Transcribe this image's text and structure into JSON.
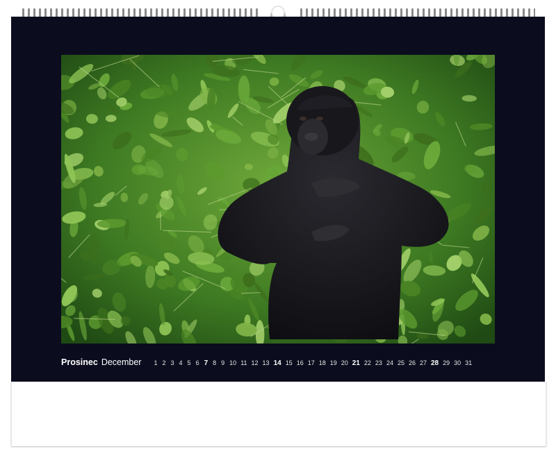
{
  "calendar": {
    "month_cz": "Prosinec",
    "month_en": "December",
    "days": [
      {
        "n": "1",
        "bold": false
      },
      {
        "n": "2",
        "bold": false
      },
      {
        "n": "3",
        "bold": false
      },
      {
        "n": "4",
        "bold": false
      },
      {
        "n": "5",
        "bold": false
      },
      {
        "n": "6",
        "bold": false
      },
      {
        "n": "7",
        "bold": true
      },
      {
        "n": "8",
        "bold": false
      },
      {
        "n": "9",
        "bold": false
      },
      {
        "n": "10",
        "bold": false
      },
      {
        "n": "11",
        "bold": false
      },
      {
        "n": "12",
        "bold": false
      },
      {
        "n": "13",
        "bold": false
      },
      {
        "n": "14",
        "bold": true
      },
      {
        "n": "15",
        "bold": false
      },
      {
        "n": "16",
        "bold": false
      },
      {
        "n": "17",
        "bold": false
      },
      {
        "n": "18",
        "bold": false
      },
      {
        "n": "19",
        "bold": false
      },
      {
        "n": "20",
        "bold": false
      },
      {
        "n": "21",
        "bold": true
      },
      {
        "n": "22",
        "bold": false
      },
      {
        "n": "23",
        "bold": false
      },
      {
        "n": "24",
        "bold": false
      },
      {
        "n": "25",
        "bold": false
      },
      {
        "n": "26",
        "bold": false
      },
      {
        "n": "27",
        "bold": false
      },
      {
        "n": "28",
        "bold": true
      },
      {
        "n": "29",
        "bold": false
      },
      {
        "n": "30",
        "bold": false
      },
      {
        "n": "31",
        "bold": false
      }
    ]
  },
  "colors": {
    "sheet": "#0b0d1e",
    "foliage": "#4f8a2a",
    "gorilla": "#151519"
  }
}
